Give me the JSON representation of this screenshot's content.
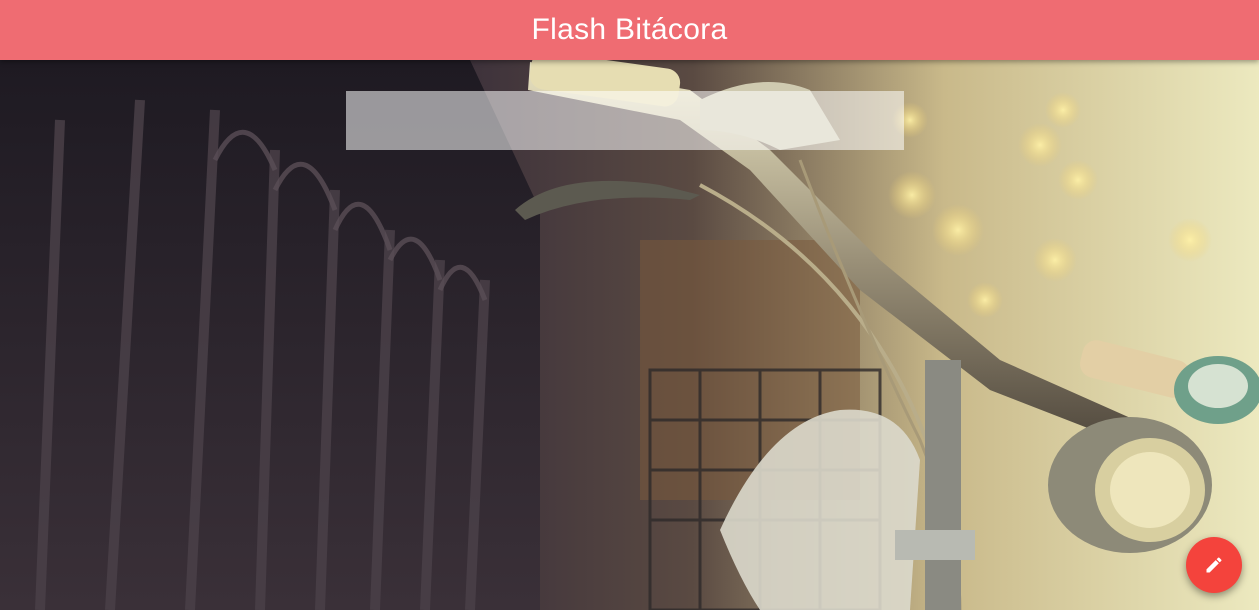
{
  "header": {
    "title": "Flash Bitácora"
  },
  "search": {
    "value": "",
    "placeholder": ""
  },
  "background": {
    "icon": "bicycle-photo"
  },
  "fab": {
    "icon": "pencil-icon",
    "color": "#f4433c"
  },
  "colors": {
    "header": "#ef6c72",
    "fab": "#f4433c"
  }
}
